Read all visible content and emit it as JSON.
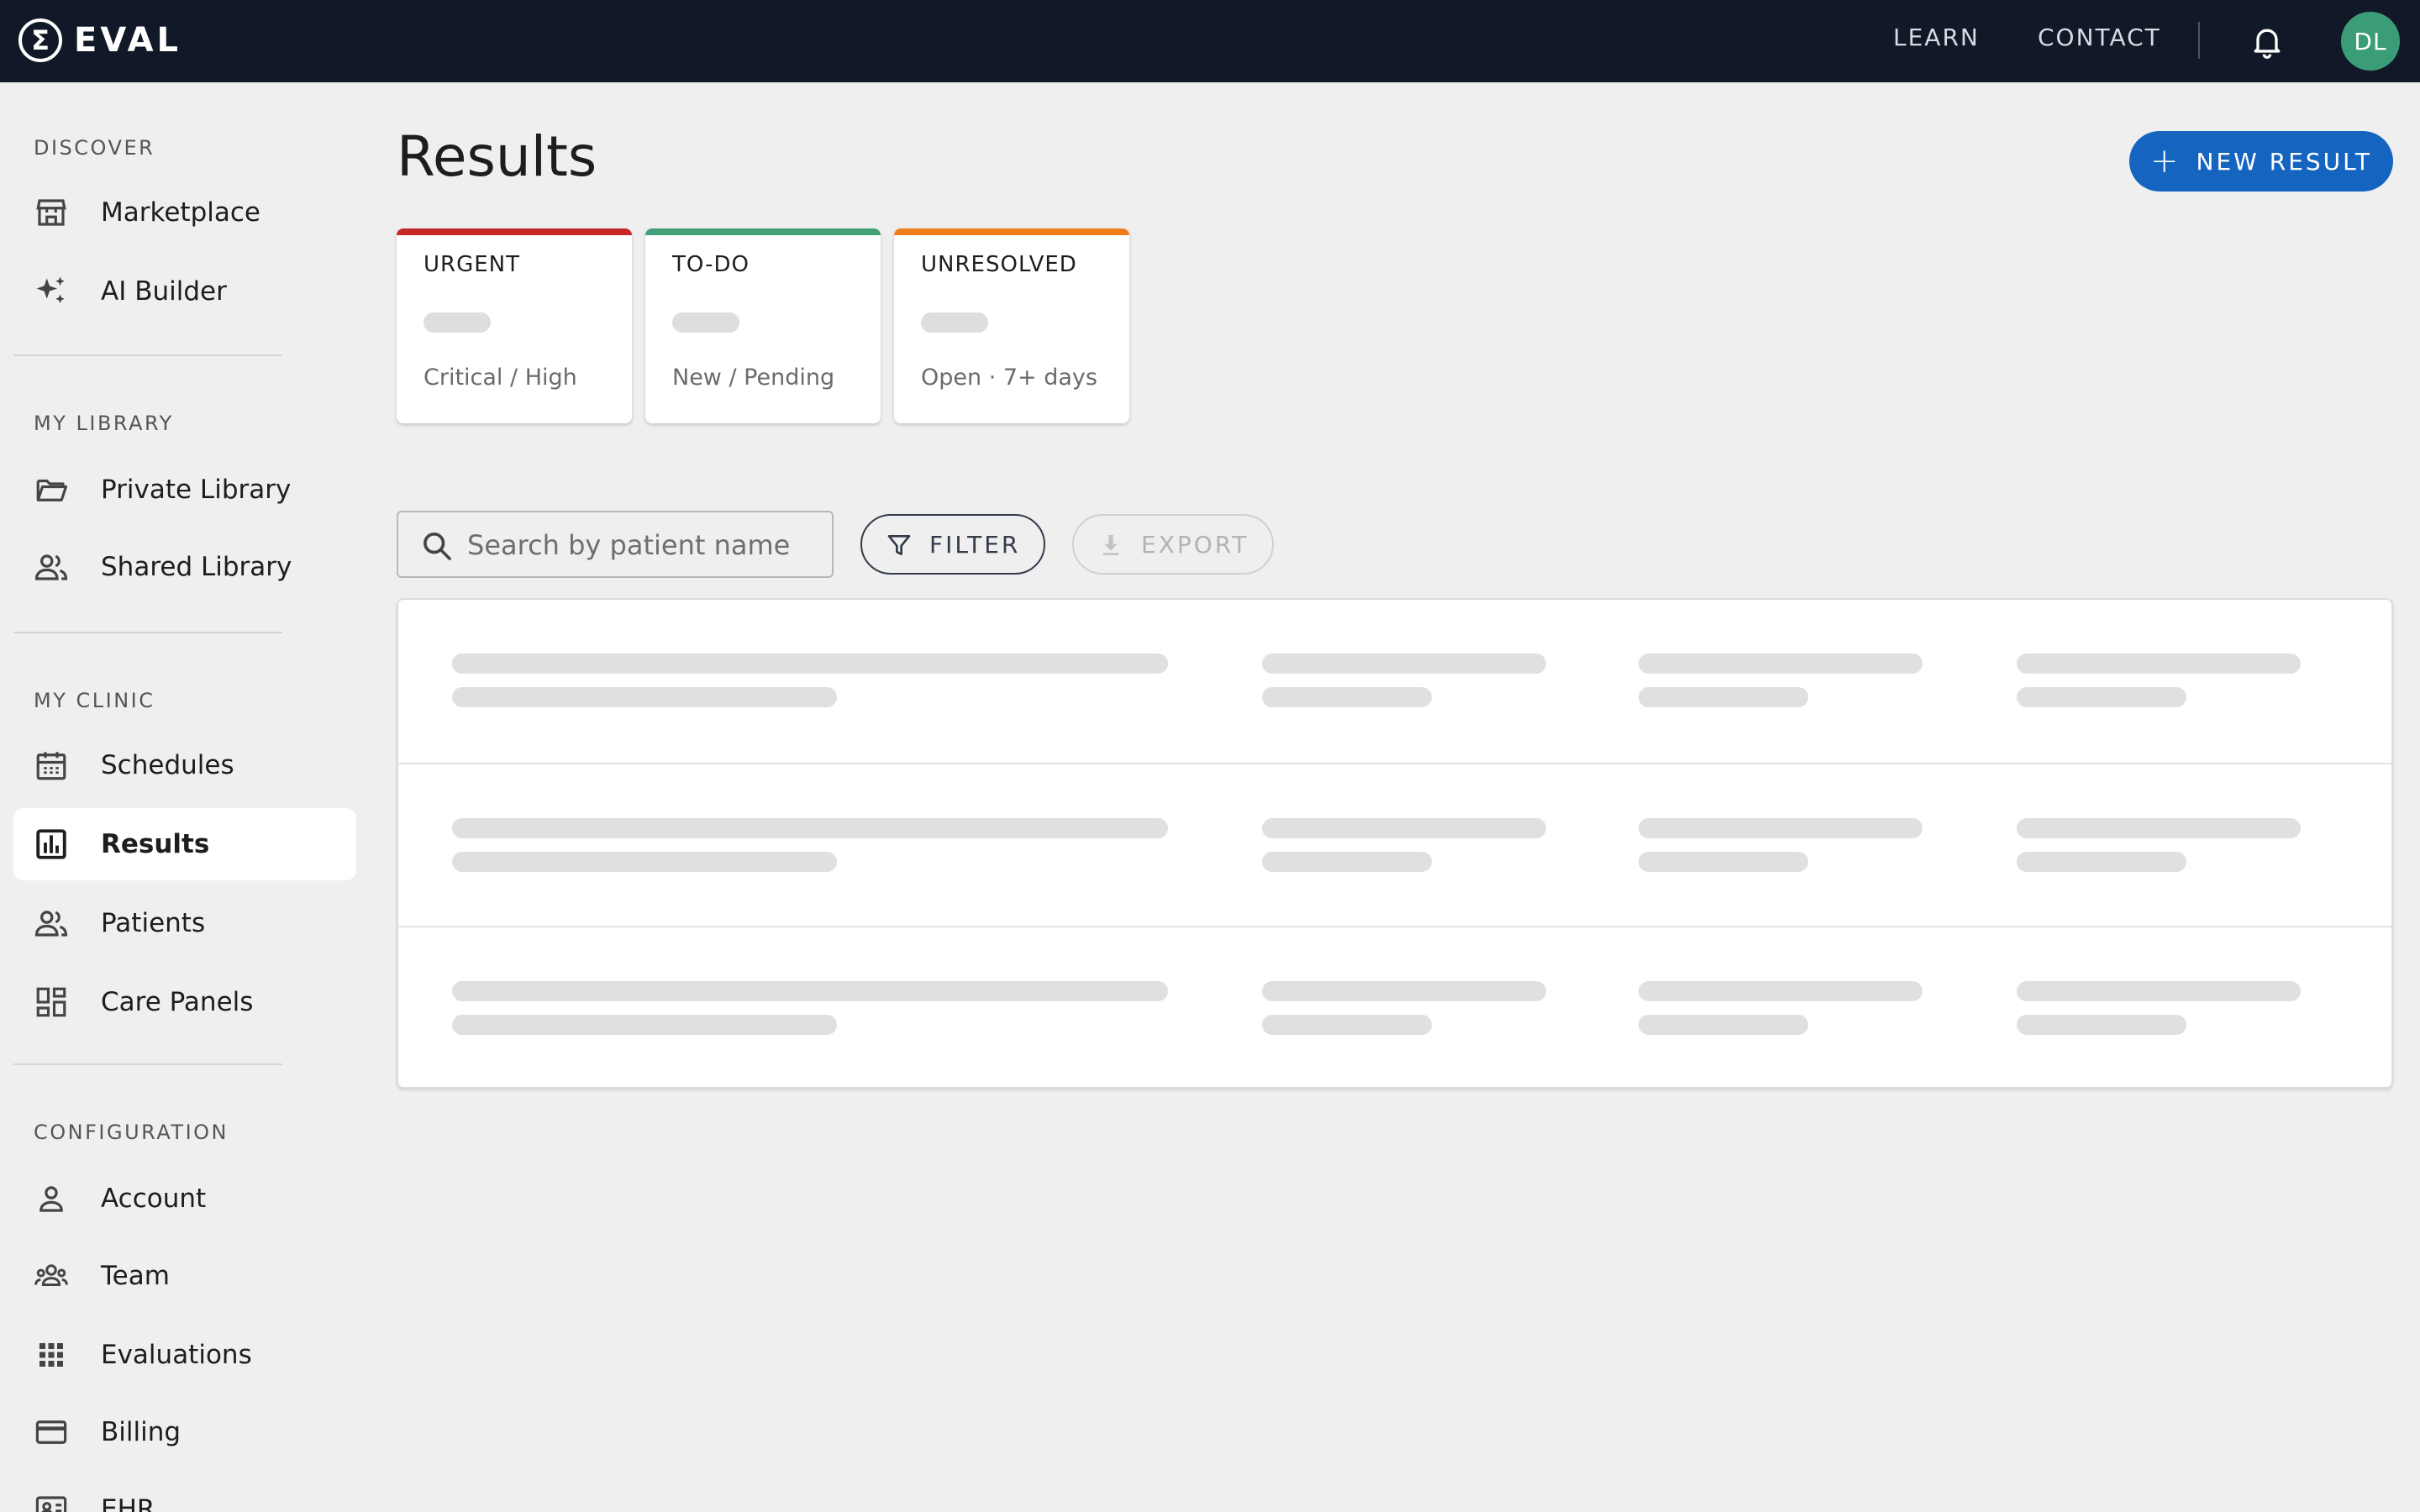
{
  "app": {
    "logo_text": "EVAL",
    "logo_symbol": "Σ"
  },
  "topbar": {
    "learn": "LEARN",
    "contact": "CONTACT",
    "notification_icon": "bell-icon",
    "avatar_initials": "DL",
    "avatar_color": "#3b9d77"
  },
  "sidebar": {
    "sections": [
      {
        "label": "DISCOVER",
        "items": [
          {
            "label": "Marketplace",
            "icon": "storefront-icon"
          },
          {
            "label": "AI Builder",
            "icon": "sparkles-icon"
          }
        ]
      },
      {
        "label": "MY LIBRARY",
        "items": [
          {
            "label": "Private Library",
            "icon": "folder-open-icon"
          },
          {
            "label": "Shared Library",
            "icon": "people-icon"
          }
        ]
      },
      {
        "label": "MY CLINIC",
        "items": [
          {
            "label": "Schedules",
            "icon": "calendar-icon"
          },
          {
            "label": "Results",
            "icon": "bar-chart-icon",
            "active": true
          },
          {
            "label": "Patients",
            "icon": "people-icon"
          },
          {
            "label": "Care Panels",
            "icon": "dashboard-icon"
          }
        ]
      },
      {
        "label": "CONFIGURATION",
        "items": [
          {
            "label": "Account",
            "icon": "person-icon"
          },
          {
            "label": "Team",
            "icon": "group-icon"
          },
          {
            "label": "Evaluations",
            "icon": "apps-grid-icon"
          },
          {
            "label": "Billing",
            "icon": "credit-card-icon"
          },
          {
            "label": "EHR",
            "icon": "id-card-icon"
          }
        ]
      }
    ]
  },
  "main": {
    "title": "Results",
    "new_button": "NEW RESULT",
    "cards": [
      {
        "title": "URGENT",
        "subtitle": "Critical / High",
        "accent": "#c62828"
      },
      {
        "title": "TO-DO",
        "subtitle": "New / Pending",
        "accent": "#43a07a"
      },
      {
        "title": "UNRESOLVED",
        "subtitle": "Open · 7+ days",
        "accent": "#ef7d1a"
      }
    ],
    "search_placeholder": "Search by patient name",
    "filter_label": "FILTER",
    "export_label": "EXPORT"
  },
  "colors": {
    "topbar": "#111827",
    "primary": "#1565c0",
    "background": "#efefef"
  }
}
